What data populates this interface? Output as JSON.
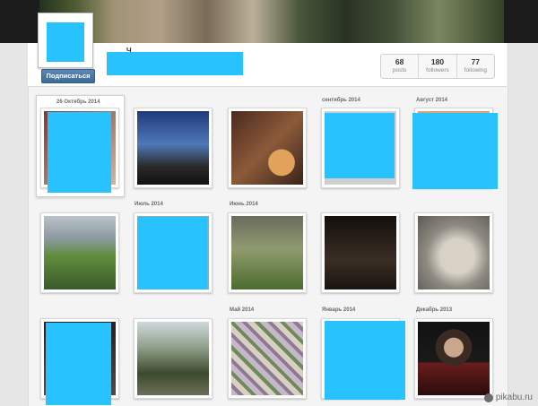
{
  "profile": {
    "name_visible_fragment": "Ч",
    "follow_label": "Подписаться",
    "stats": [
      {
        "value": "68",
        "label": "posts"
      },
      {
        "value": "180",
        "label": "followers"
      },
      {
        "value": "77",
        "label": "following"
      }
    ]
  },
  "grid": {
    "date_labels": {
      "oct2014": "26 Октябрь 2014",
      "sep2014": "сентябрь 2014",
      "aug2014": "Август 2014",
      "jul2014": "Июль 2014",
      "jun2014": "Июнь 2014",
      "may2014": "Май 2014",
      "jan2014": "Январь 2014",
      "dec2013": "Декабрь 2013"
    }
  },
  "watermark": {
    "text": "pikabu.ru"
  }
}
